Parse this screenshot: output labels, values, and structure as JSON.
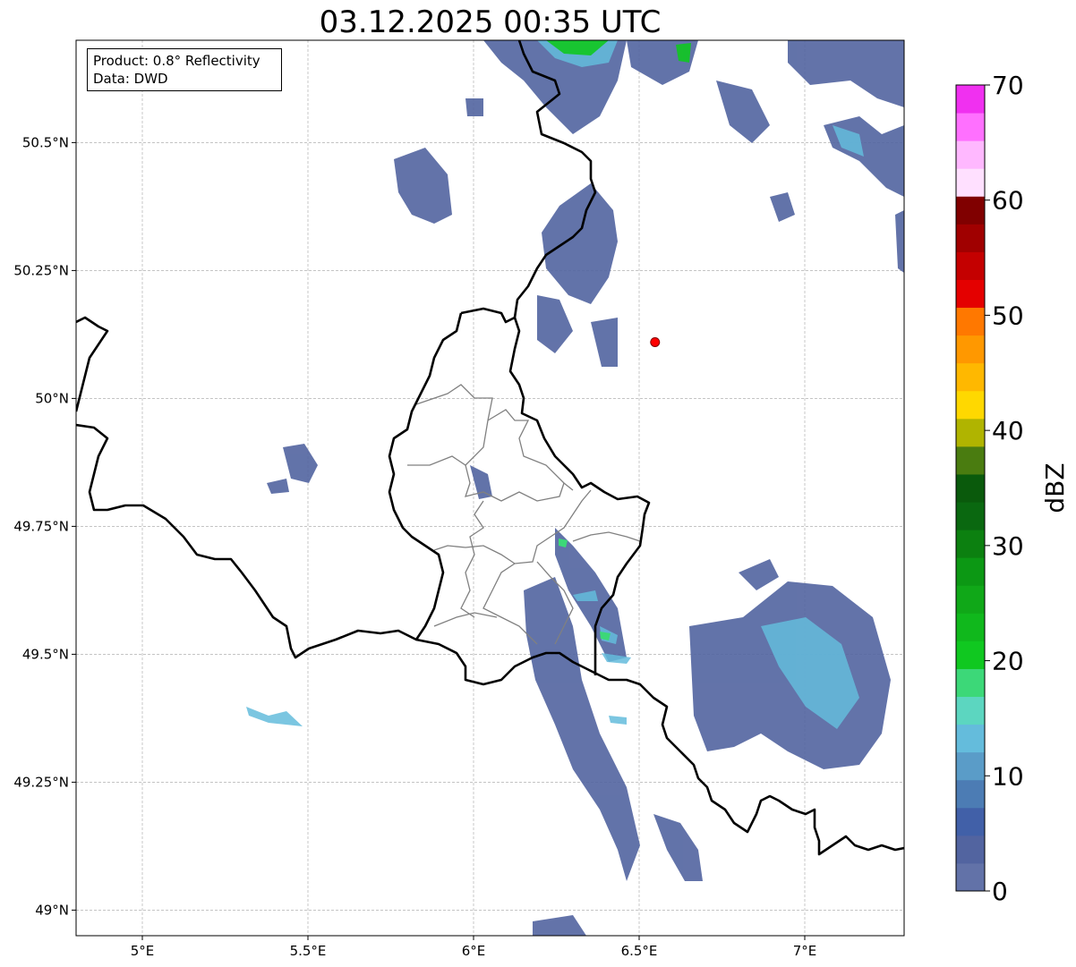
{
  "title": "03.12.2025 00:35 UTC",
  "info": {
    "product": "Product: 0.8° Reflectivity",
    "source": "Data: DWD"
  },
  "axes": {
    "x_ticks": [
      {
        "value": 5.0,
        "label": "5°E"
      },
      {
        "value": 5.5,
        "label": "5.5°E"
      },
      {
        "value": 6.0,
        "label": "6°E"
      },
      {
        "value": 6.5,
        "label": "6.5°E"
      },
      {
        "value": 7.0,
        "label": "7°E"
      }
    ],
    "y_ticks": [
      {
        "value": 50.5,
        "label": "50.5°N"
      },
      {
        "value": 50.25,
        "label": "50.25°N"
      },
      {
        "value": 50.0,
        "label": "50°N"
      },
      {
        "value": 49.75,
        "label": "49.75°N"
      },
      {
        "value": 49.5,
        "label": "49.5°N"
      },
      {
        "value": 49.25,
        "label": "49.25°N"
      },
      {
        "value": 49.0,
        "label": "49°N"
      }
    ],
    "lon_range": [
      4.8,
      7.3
    ],
    "lat_range": [
      48.95,
      50.7
    ],
    "grid": true
  },
  "radar_site": {
    "lon": 6.548,
    "lat": 50.11,
    "color": "#ff0000"
  },
  "colorbar": {
    "unit": "dBZ",
    "min": 0,
    "max": 70,
    "tick_values": [
      0,
      10,
      20,
      30,
      40,
      50,
      60,
      70
    ],
    "tick_labels": [
      "0",
      "10",
      "20",
      "30",
      "40",
      "50",
      "60",
      "70"
    ],
    "colors": [
      "#6272a8",
      "#5264a0",
      "#4160a8",
      "#4c7cb4",
      "#5a9cc8",
      "#64bcdc",
      "#5cd6c0",
      "#3cd878",
      "#10c820",
      "#10b81c",
      "#10a818",
      "#0c9814",
      "#0c8010",
      "#0a6810",
      "#0a5a0c",
      "#4a7c10",
      "#b0b400",
      "#ffd800",
      "#ffb800",
      "#ff9800",
      "#ff7800",
      "#e40000",
      "#c40000",
      "#a00000",
      "#800000",
      "#ffe0ff",
      "#ffb8ff",
      "#ff70ff",
      "#f030f0"
    ]
  }
}
